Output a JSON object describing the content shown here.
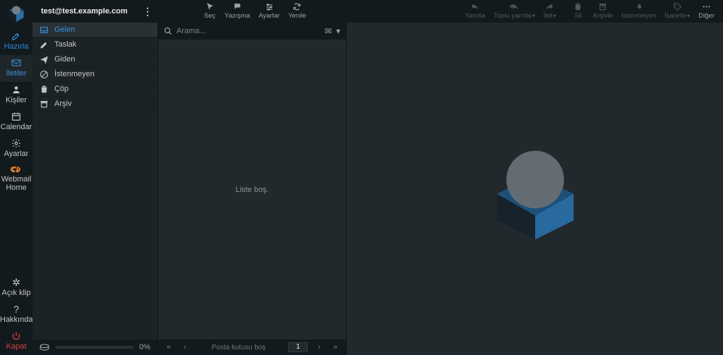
{
  "account": "test@test.example.com",
  "nav": {
    "compose": "Hazırla",
    "mail": "İletiler",
    "contacts": "Kişiler",
    "calendar": "Calendar",
    "settings": "Ayarlar",
    "webmail_home_line1": "Webmail",
    "webmail_home_line2": "Home",
    "theme": "Açık klip",
    "about": "Hakkında",
    "logout": "Kapat"
  },
  "toolbar_left": {
    "select": "Seç",
    "thread": "Yazışma",
    "options": "Ayarlar",
    "refresh": "Yenile"
  },
  "toolbar_right": {
    "reply": "Yanıtla",
    "reply_all": "Toplu yanıtla",
    "forward": "İlet",
    "delete": "Sil",
    "archive": "Arşivle",
    "junk": "İstenmeyen",
    "mark": "İşaretle",
    "more": "Diğer"
  },
  "folders": [
    {
      "key": "inbox",
      "label": "Gelen"
    },
    {
      "key": "drafts",
      "label": "Taslak"
    },
    {
      "key": "sent",
      "label": "Giden"
    },
    {
      "key": "junk",
      "label": "İstenmeyen"
    },
    {
      "key": "trash",
      "label": "Çöp"
    },
    {
      "key": "archive",
      "label": "Arşiv"
    }
  ],
  "quota_percent": "0%",
  "search_placeholder": "Arama...",
  "list_empty": "Liste boş.",
  "pager": {
    "status": "Posta kutusu boş",
    "page": "1"
  }
}
